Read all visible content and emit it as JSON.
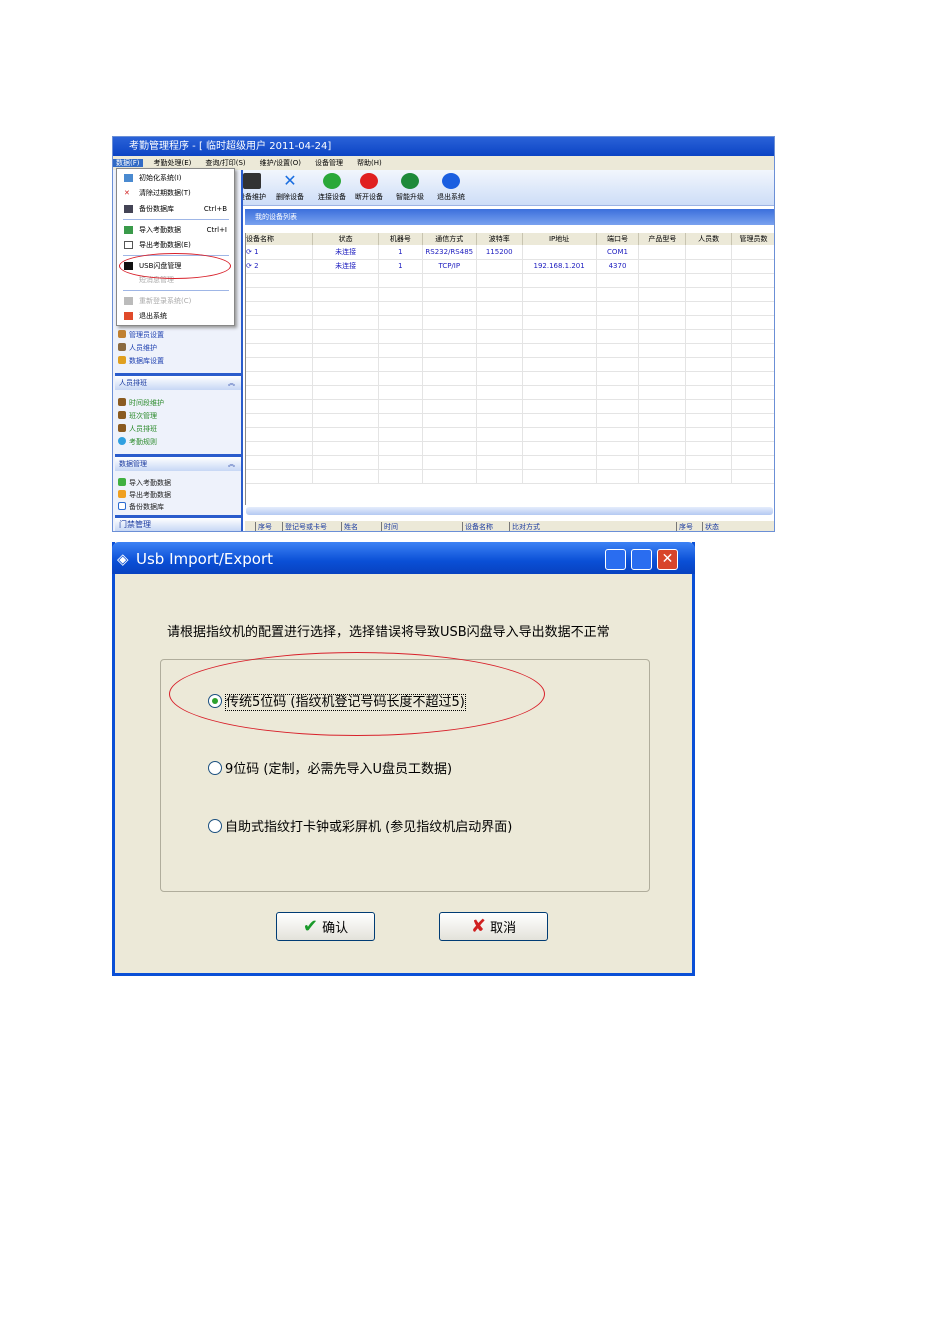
{
  "app": {
    "title": "考勤管理程序 - [ 临时超级用户 2011-04-24]",
    "menu": [
      "数据(F)",
      "考勤处理(E)",
      "查询/打印(S)",
      "维护/设置(O)",
      "设备管理",
      "帮助(H)"
    ],
    "toolbar": [
      "设备维护",
      "删除设备",
      "连接设备",
      "断开设备",
      "智能升级",
      "退出系统"
    ],
    "list_title": "我的设备列表",
    "columns": [
      "设备名称",
      "状态",
      "机器号",
      "通信方式",
      "波特率",
      "IP地址",
      "端口号",
      "产品型号",
      "人员数",
      "管理员数"
    ],
    "rows": [
      [
        "1",
        "未连接",
        "1",
        "RS232/RS485",
        "115200",
        "",
        "COM1",
        "",
        "",
        ""
      ],
      [
        "2",
        "未连接",
        "1",
        "TCP/IP",
        "",
        "192.168.1.201",
        "4370",
        "",
        "",
        ""
      ]
    ],
    "dropdown": [
      {
        "label": "初始化系统(I)",
        "shortcut": ""
      },
      {
        "label": "清除过期数据(T)",
        "shortcut": ""
      },
      {
        "label": "备份数据库",
        "shortcut": "Ctrl+B"
      },
      {
        "label": "导入考勤数据",
        "shortcut": "Ctrl+I"
      },
      {
        "label": "导出考勤数据(E)",
        "shortcut": ""
      },
      {
        "label": "USB闪盘管理",
        "shortcut": ""
      },
      {
        "label": "短消息管理",
        "shortcut": ""
      },
      {
        "label": "重新登录系统(C)",
        "shortcut": ""
      },
      {
        "label": "退出系统",
        "shortcut": ""
      }
    ],
    "sidebar": {
      "items_top": [
        "管理员设置",
        "人员维护",
        "数据库设置"
      ],
      "section1": "人员排班",
      "items1": [
        "时间段维护",
        "班次管理",
        "人员排班",
        "考勤规则"
      ],
      "section2": "数据管理",
      "items2": [
        "导入考勤数据",
        "导出考勤数据",
        "备份数据库"
      ],
      "section3": "门禁管理"
    },
    "bottom_cols_left": [
      "序号",
      "登记号或卡号",
      "姓名",
      "时间",
      "设备名称",
      "比对方式"
    ],
    "bottom_cols_right": [
      "序号",
      "状态"
    ]
  },
  "dialog": {
    "title": "Usb Import/Export",
    "instruction": "请根据指纹机的配置进行选择，选择错误将导致USB闪盘导入导出数据不正常",
    "options": [
      {
        "label": "传统5位码 (指纹机登记号码长度不超过5)",
        "selected": true
      },
      {
        "label": "9位码 (定制，必需先导入U盘员工数据)",
        "selected": false
      },
      {
        "label": "自助式指纹打卡钟或彩屏机 (参见指纹机启动界面)",
        "selected": false
      }
    ],
    "ok": "确认",
    "cancel": "取消"
  }
}
